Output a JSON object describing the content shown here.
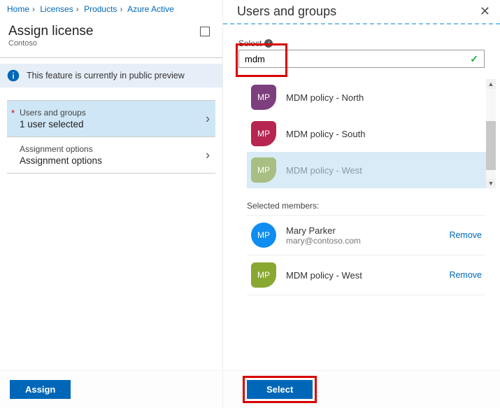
{
  "breadcrumb": [
    "Home",
    "Licenses",
    "Products",
    "Azure Active"
  ],
  "left": {
    "title": "Assign license",
    "tenant": "Contoso",
    "banner": "This feature is currently in public preview",
    "items": [
      {
        "label": "Users and groups",
        "value": "1 user selected",
        "required": true,
        "selected": true
      },
      {
        "label": "Assignment options",
        "value": "Assignment options",
        "required": false,
        "selected": false
      }
    ],
    "assign_btn": "Assign"
  },
  "right": {
    "title": "Users and groups",
    "select_label": "Select",
    "search_value": "mdm",
    "results": [
      {
        "initials": "MP",
        "name": "MDM policy - North",
        "color": "av-purple"
      },
      {
        "initials": "MP",
        "name": "MDM policy - South",
        "color": "av-crimson"
      },
      {
        "initials": "MP",
        "name": "MDM policy - West",
        "color": "av-olive",
        "highlighted": true
      }
    ],
    "selected_label": "Selected members:",
    "members": [
      {
        "initials": "MP",
        "name": "Mary Parker",
        "sub": "mary@contoso.com",
        "color": "av-blue"
      },
      {
        "initials": "MP",
        "name": "MDM policy - West",
        "sub": "",
        "color": "av-olive2"
      }
    ],
    "remove_label": "Remove",
    "select_btn": "Select"
  }
}
